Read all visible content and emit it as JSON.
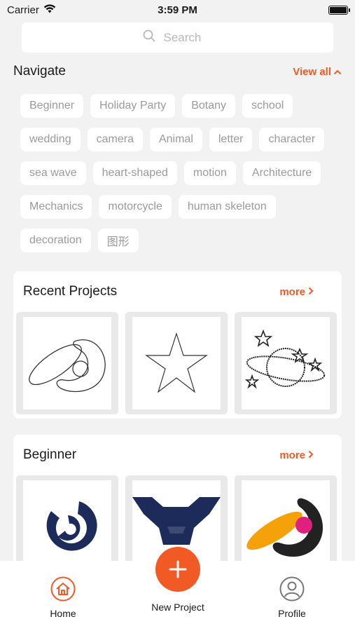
{
  "status": {
    "carrier": "Carrier",
    "time": "3:59 PM",
    "battery_level": 1.0
  },
  "search": {
    "placeholder": "Search",
    "value": "",
    "icon": "search-icon"
  },
  "navigate": {
    "title": "Navigate",
    "view_all": "View all",
    "tags": [
      "Beginner",
      "Holiday Party",
      "Botany",
      "school",
      "wedding",
      "camera",
      "Animal",
      "letter",
      "character",
      "sea wave",
      "heart-shaped",
      "motion",
      "Architecture",
      "Mechanics",
      "motorcycle",
      "human skeleton",
      "decoration",
      "图形"
    ]
  },
  "recent": {
    "title": "Recent Projects",
    "more": "more",
    "items": [
      {
        "icon": "ring-swoosh-icon"
      },
      {
        "icon": "star-icon"
      },
      {
        "icon": "planet-stars-icon"
      }
    ]
  },
  "beginner": {
    "title": "Beginner",
    "more": "more",
    "items": [
      {
        "icon": "navy-spiral-logo-icon"
      },
      {
        "icon": "navy-ribbon-medal-icon"
      },
      {
        "icon": "orange-pink-swoosh-icon"
      }
    ]
  },
  "tabbar": {
    "home": "Home",
    "new_project": "New Project",
    "profile": "Profile"
  },
  "colors": {
    "accent": "#f15a24",
    "navy": "#1c2b5a",
    "background": "#f2f2f2"
  }
}
